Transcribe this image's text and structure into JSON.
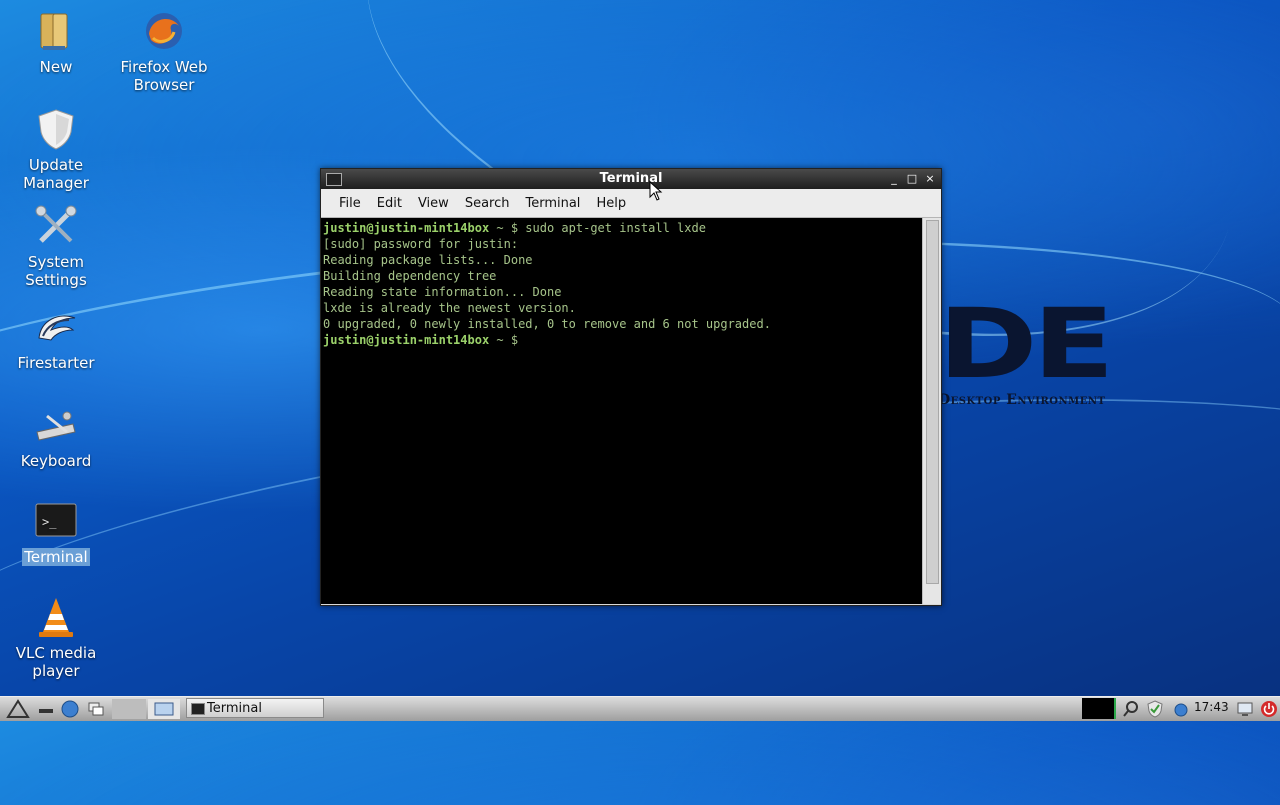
{
  "desktop": {
    "brand_big": "DE",
    "brand_sub": "Desktop Environment",
    "icons": [
      {
        "label": "New",
        "icon": "folder-icon"
      },
      {
        "label": "Firefox Web Browser",
        "icon": "firefox-icon"
      },
      {
        "label": "Update Manager",
        "icon": "shield-icon"
      },
      {
        "label": "System Settings",
        "icon": "tools-icon"
      },
      {
        "label": "Firestarter",
        "icon": "firestarter-icon"
      },
      {
        "label": "Keyboard",
        "icon": "keyboard-icon"
      },
      {
        "label": "Terminal",
        "icon": "terminal-icon"
      },
      {
        "label": "VLC media player",
        "icon": "vlc-cone-icon"
      }
    ]
  },
  "window": {
    "title": "Terminal",
    "controls": {
      "minimize": "_",
      "maximize": "□",
      "close": "×"
    },
    "menu": [
      "File",
      "Edit",
      "View",
      "Search",
      "Terminal",
      "Help"
    ],
    "terminal": {
      "prompt_user": "justin@justin-mint14box",
      "prompt_suffix": " ~ $ ",
      "command": "sudo apt-get install lxde",
      "output": [
        "[sudo] password for justin:",
        "Reading package lists... Done",
        "Building dependency tree",
        "Reading state information... Done",
        "lxde is already the newest version.",
        "0 upgraded, 0 newly installed, 0 to remove and 6 not upgraded."
      ]
    }
  },
  "taskbar": {
    "task_label": "Terminal",
    "clock": "17:43",
    "colors": {
      "cpu_graph": "#2ba84a",
      "power": "#d42a2a"
    }
  }
}
